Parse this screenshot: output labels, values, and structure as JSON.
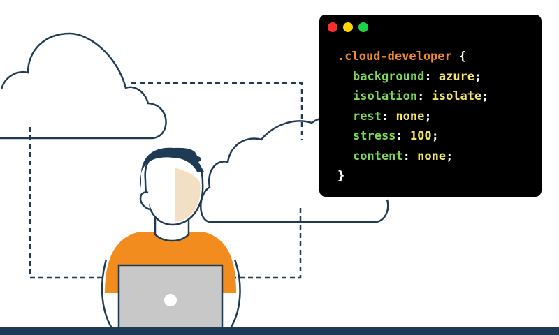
{
  "colors": {
    "navy": "#1f3a55",
    "shirt_orange": "#f28c1e",
    "skin": "#f2dfc4",
    "laptop_gray": "#c8c8c8",
    "window_bg": "#000000",
    "dot_red": "#ff2d2d",
    "dot_yellow": "#ffd400",
    "dot_green": "#1fd14a",
    "selector": "#f28c28",
    "property": "#7ed957",
    "value": "#f5e663"
  },
  "icons": {
    "window_controls": [
      "red-dot-icon",
      "yellow-dot-icon",
      "green-dot-icon"
    ]
  },
  "code": {
    "selector": ".cloud-developer",
    "open_brace": "{",
    "close_brace": "}",
    "declarations": [
      {
        "property": "background",
        "value": "azure"
      },
      {
        "property": "isolation",
        "value": "isolate"
      },
      {
        "property": "rest",
        "value": "none"
      },
      {
        "property": "stress",
        "value": "100"
      },
      {
        "property": "content",
        "value": "none"
      }
    ]
  }
}
